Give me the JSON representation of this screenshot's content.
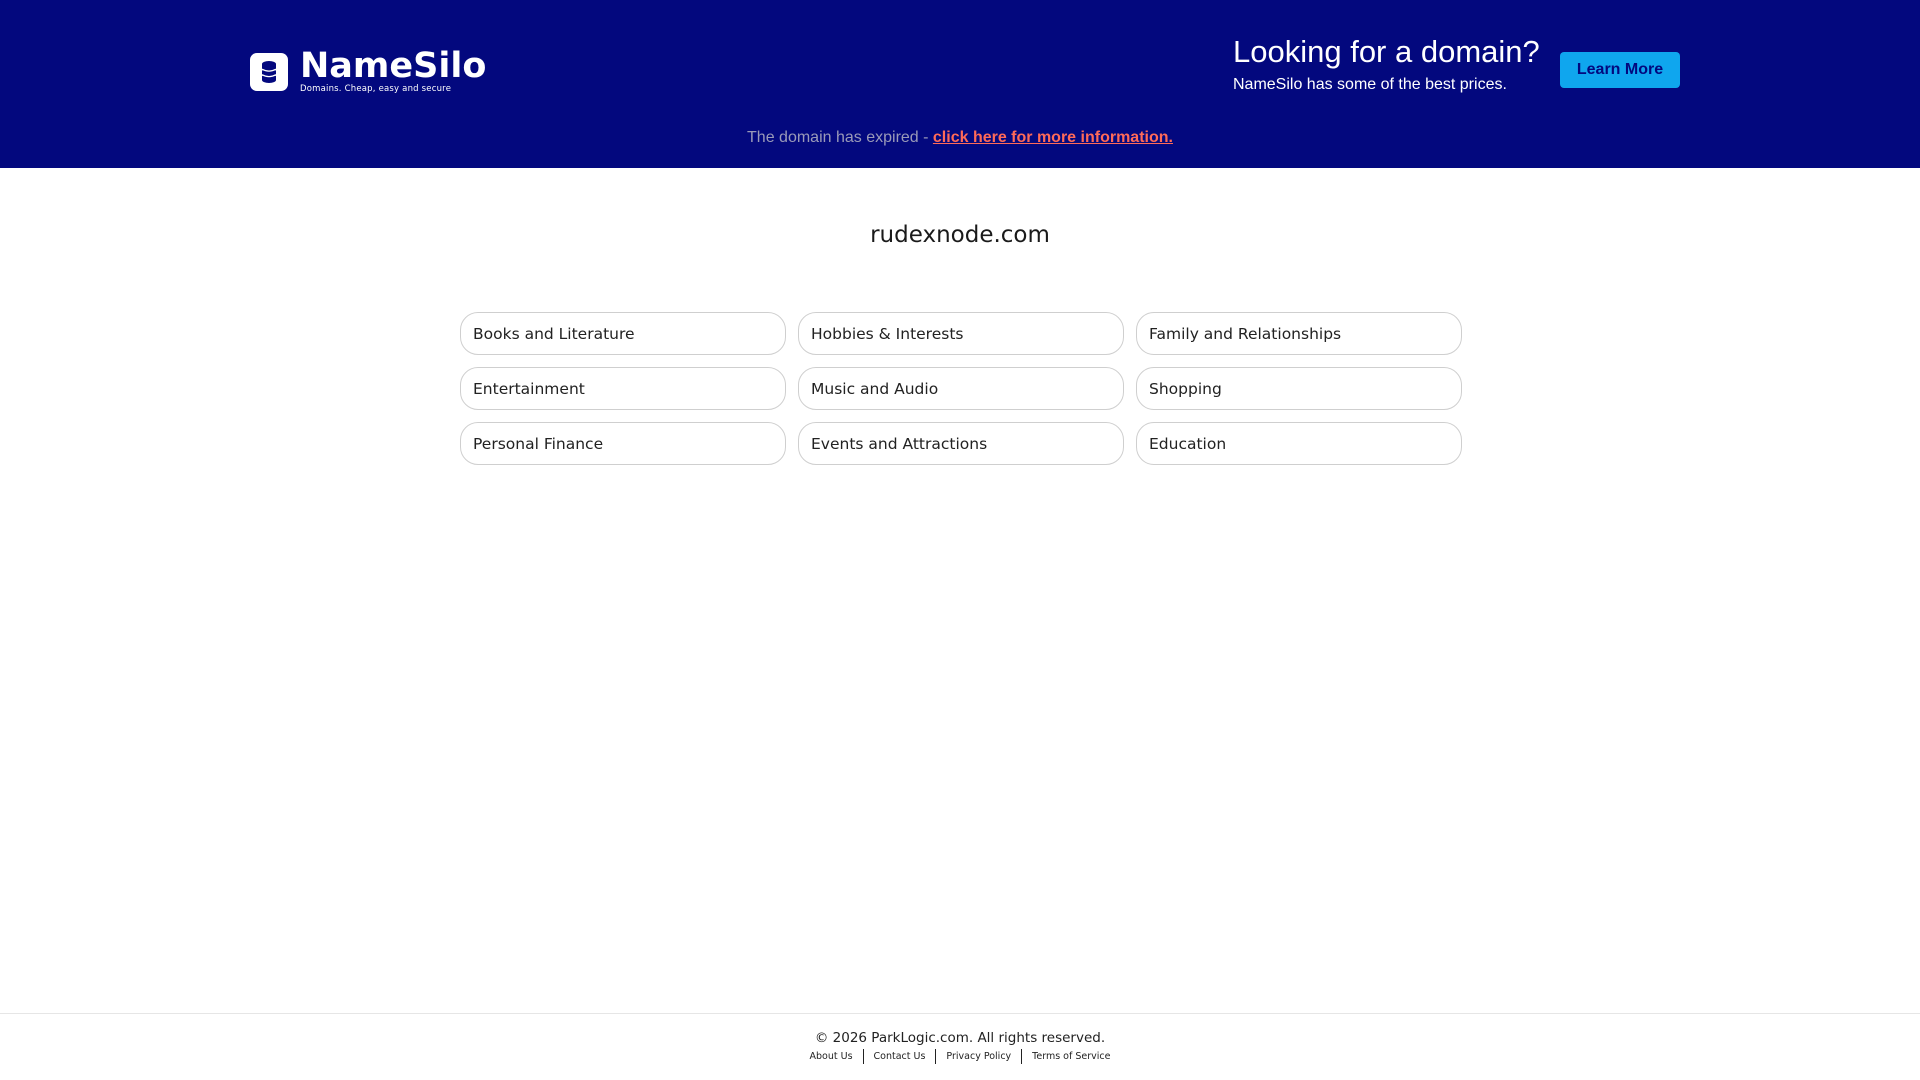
{
  "header": {
    "logo": {
      "name": "NameSilo",
      "tagline": "Domains. Cheap, easy and secure",
      "icon": "database-icon"
    },
    "promo_title": "Looking for a domain?",
    "promo_subtitle": "NameSilo has some of the best prices.",
    "learn_more_label": "Learn More",
    "colors": {
      "background": "#03087e",
      "button": "#0fa6ee",
      "link": "#ff6a58"
    }
  },
  "notice": {
    "text": "The domain has expired - ",
    "link_label": "click here for more information."
  },
  "main": {
    "domain": "rudexnode.com",
    "categories": [
      "Books and Literature",
      "Hobbies & Interests",
      "Family and Relationships",
      "Entertainment",
      "Music and Audio",
      "Shopping",
      "Personal Finance",
      "Events and Attractions",
      "Education"
    ]
  },
  "footer": {
    "copyright": "© 2026 ParkLogic.com. All rights reserved.",
    "links": [
      "About Us",
      "Contact Us",
      "Privacy Policy",
      "Terms of Service"
    ]
  }
}
